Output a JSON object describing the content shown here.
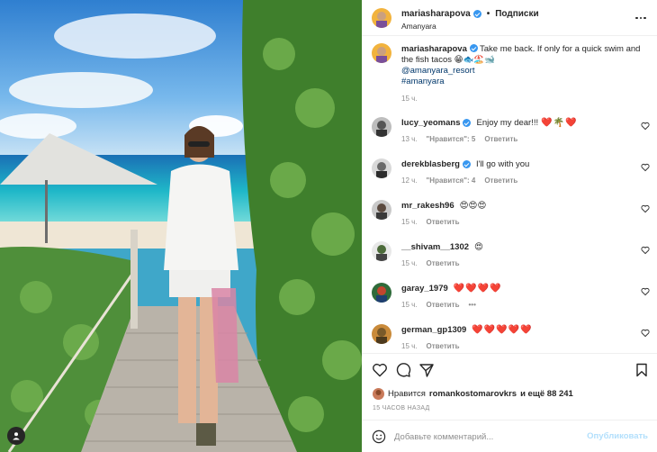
{
  "post": {
    "username": "mariasharapova",
    "follow_separator": "•",
    "follow_label": "Подписки",
    "location": "Amanyara"
  },
  "caption": {
    "username": "mariasharapova",
    "text": "Take me back. If only for a quick swim and the fish tacos 😁🐟🏖️🐋",
    "mention": "@amanyara_resort",
    "hashtag": "#amanyara",
    "time": "15 ч."
  },
  "comments": [
    {
      "username": "lucy_yeomans",
      "verified": true,
      "text": "Enjoy my dear!!!",
      "emoji": "❤️🌴❤️",
      "time": "13 ч.",
      "likes": "\"Нравится\": 5",
      "reply": "Ответить"
    },
    {
      "username": "derekblasberg",
      "verified": true,
      "text": "I'll go with you",
      "emoji": "",
      "time": "12 ч.",
      "likes": "\"Нравится\": 4",
      "reply": "Ответить"
    },
    {
      "username": "mr_rakesh96",
      "verified": false,
      "text": "",
      "emoji": "😍😍😍",
      "time": "15 ч.",
      "likes": "",
      "reply": "Ответить"
    },
    {
      "username": "__shivam__1302",
      "verified": false,
      "text": "",
      "emoji": "😍",
      "time": "15 ч.",
      "likes": "",
      "reply": "Ответить"
    },
    {
      "username": "garay_1979",
      "verified": false,
      "text": "",
      "emoji": "❤️❤️❤️❤️",
      "time": "15 ч.",
      "likes": "",
      "reply": "Ответить"
    },
    {
      "username": "german_gp1309",
      "verified": false,
      "text": "",
      "emoji": "❤️❤️❤️❤️❤️",
      "time": "15 ч.",
      "likes": "",
      "reply": "Ответить"
    }
  ],
  "more_replies": "•••",
  "likes": {
    "prefix": "Нравится",
    "user": "romankostomarovkrs",
    "suffix": "и ещё 88 241"
  },
  "timestamp": "15 ЧАСОВ НАЗАД",
  "comment_input": {
    "placeholder": "Добавьте комментарий...",
    "submit": "Опубликовать"
  },
  "icons": {
    "header_more": "more-horizontal-icon",
    "like": "heart-icon",
    "comment": "comment-icon",
    "share": "paper-plane-icon",
    "save": "bookmark-icon",
    "emoji": "smiley-icon",
    "tag": "user-tag-icon"
  },
  "colors": {
    "verified": "#3897f0",
    "link": "#00376b",
    "muted": "#8e8e8e",
    "publish_disabled": "#b2dffc",
    "heart": "#ed1c24"
  }
}
